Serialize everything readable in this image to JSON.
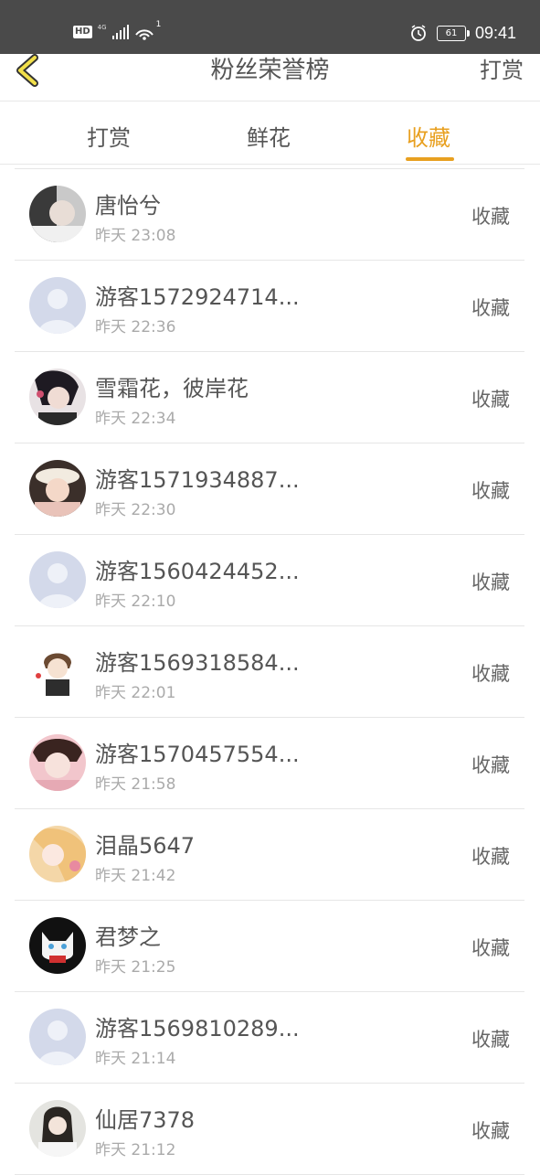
{
  "status_bar": {
    "hd": "HD",
    "network": "4G",
    "wifi_count": "1",
    "battery": "61",
    "time": "09:41"
  },
  "header": {
    "title": "粉丝荣誉榜",
    "right_label": "打赏"
  },
  "tabs": [
    {
      "label": "打赏",
      "active": false
    },
    {
      "label": "鲜花",
      "active": false
    },
    {
      "label": "收藏",
      "active": true
    }
  ],
  "accent_color": "#e8a020",
  "fans": [
    {
      "name": "唐怡兮",
      "time": "昨天 23:08",
      "action": "收藏",
      "avatar": "photo"
    },
    {
      "name": "游客1572924714...",
      "time": "昨天 22:36",
      "action": "收藏",
      "avatar": "default"
    },
    {
      "name": "雪霜花，彼岸花",
      "time": "昨天 22:34",
      "action": "收藏",
      "avatar": "photo"
    },
    {
      "name": "游客1571934887...",
      "time": "昨天 22:30",
      "action": "收藏",
      "avatar": "photo"
    },
    {
      "name": "游客1560424452...",
      "time": "昨天 22:10",
      "action": "收藏",
      "avatar": "default"
    },
    {
      "name": "游客1569318584...",
      "time": "昨天 22:01",
      "action": "收藏",
      "avatar": "cartoon"
    },
    {
      "name": "游客1570457554...",
      "time": "昨天 21:58",
      "action": "收藏",
      "avatar": "photo"
    },
    {
      "name": "泪晶5647",
      "time": "昨天 21:42",
      "action": "收藏",
      "avatar": "anime"
    },
    {
      "name": "君梦之",
      "time": "昨天 21:25",
      "action": "收藏",
      "avatar": "cat"
    },
    {
      "name": "游客1569810289...",
      "time": "昨天 21:14",
      "action": "收藏",
      "avatar": "default"
    },
    {
      "name": "仙居7378",
      "time": "昨天 21:12",
      "action": "收藏",
      "avatar": "photo"
    }
  ]
}
